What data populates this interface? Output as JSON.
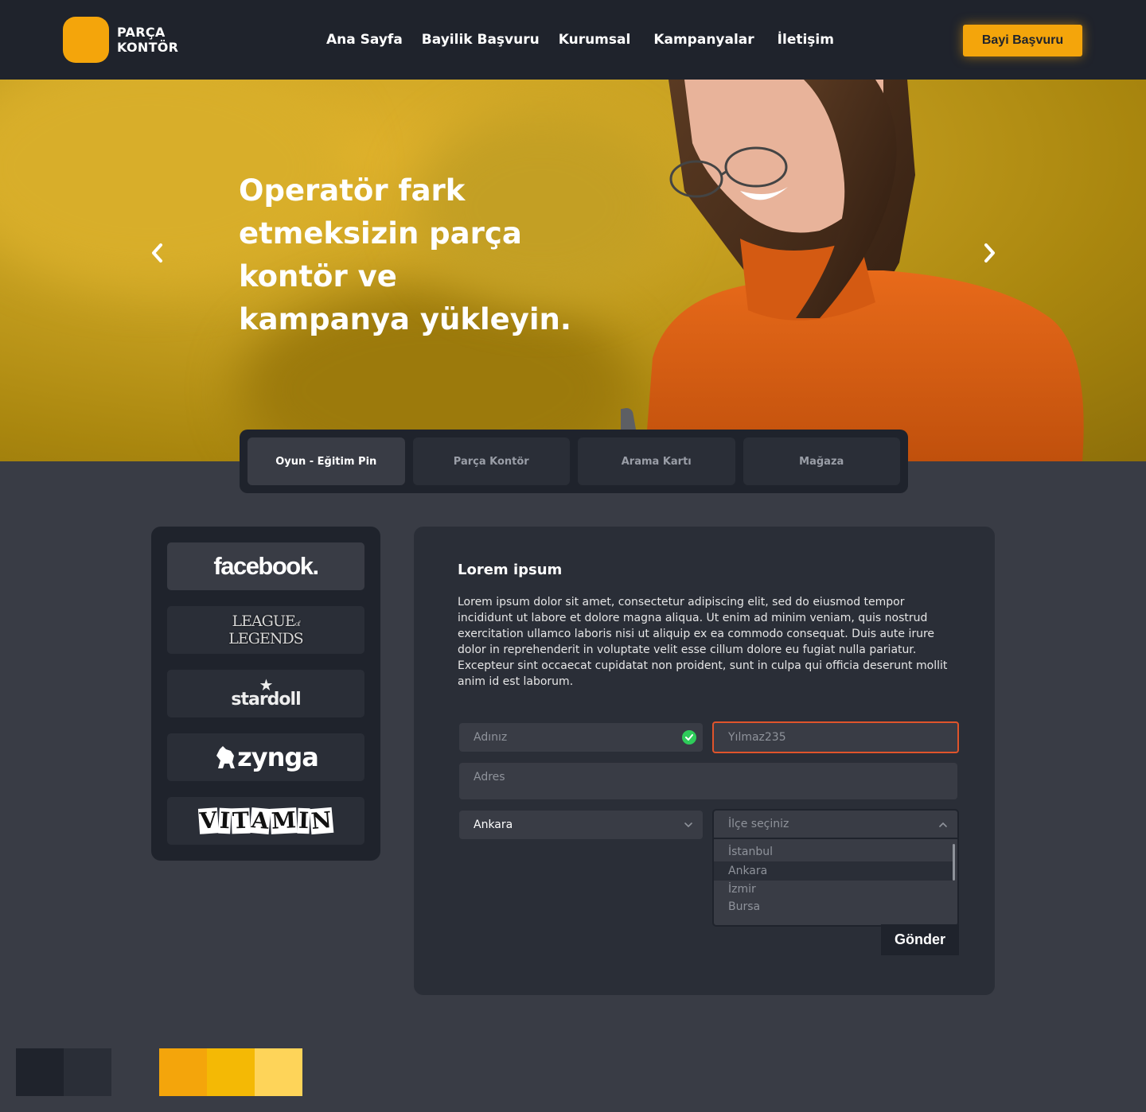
{
  "header": {
    "logo_line1": "PARÇA",
    "logo_line2": "KONTÖR",
    "nav": [
      "Ana Sayfa",
      "Bayilik Başvuru",
      "Kurumsal",
      "Kampanyalar",
      "İletişim"
    ],
    "cta_label": "Bayi Başvuru"
  },
  "hero": {
    "title": "Operatör fark etmeksizin parça kontör ve kampanya yükleyin.",
    "prev_icon": "chevron-left-icon",
    "next_icon": "chevron-right-icon"
  },
  "tabs": [
    {
      "label": "Oyun - Eğitim Pin",
      "active": true
    },
    {
      "label": "Parça Kontör",
      "active": false
    },
    {
      "label": "Arama Kartı",
      "active": false
    },
    {
      "label": "Mağaza",
      "active": false
    }
  ],
  "brands": {
    "facebook": "facebook.",
    "lol_line1": "LEAGUE",
    "lol_of": "of",
    "lol_line2": "LEGENDS",
    "stardoll": "stardoll",
    "zynga": "zynga",
    "vitamin": "VITAMIN"
  },
  "form": {
    "title": "Lorem ipsum",
    "description": "Lorem ipsum dolor sit amet, consectetur adipiscing elit, sed do eiusmod tempor incididunt ut labore et dolore magna aliqua. Ut enim ad minim veniam, quis nostrud exercitation ullamco laboris nisi ut aliquip ex ea commodo consequat. Duis aute irure dolor in reprehenderit in voluptate velit esse cillum dolore eu fugiat nulla pariatur. Excepteur sint occaecat cupidatat non proident, sunt in culpa qui officia deserunt mollit anim id est laborum.",
    "name_placeholder": "Adınız",
    "username_value": "Yılmaz235",
    "address_placeholder": "Adres",
    "city_value": "Ankara",
    "district_placeholder": "İlçe seçiniz",
    "district_options": [
      "İstanbul",
      "Ankara",
      "İzmir",
      "Bursa"
    ],
    "district_selected_index": 1,
    "submit_label": "Gönder"
  },
  "colors": {
    "dark_1": "#1f232c",
    "dark_2": "#2a2e37",
    "orange": "#f4a50b",
    "yellow": "#f4b905",
    "light_yellow": "#fed459",
    "error_border": "#e0542b",
    "success": "#2ecc5a"
  }
}
